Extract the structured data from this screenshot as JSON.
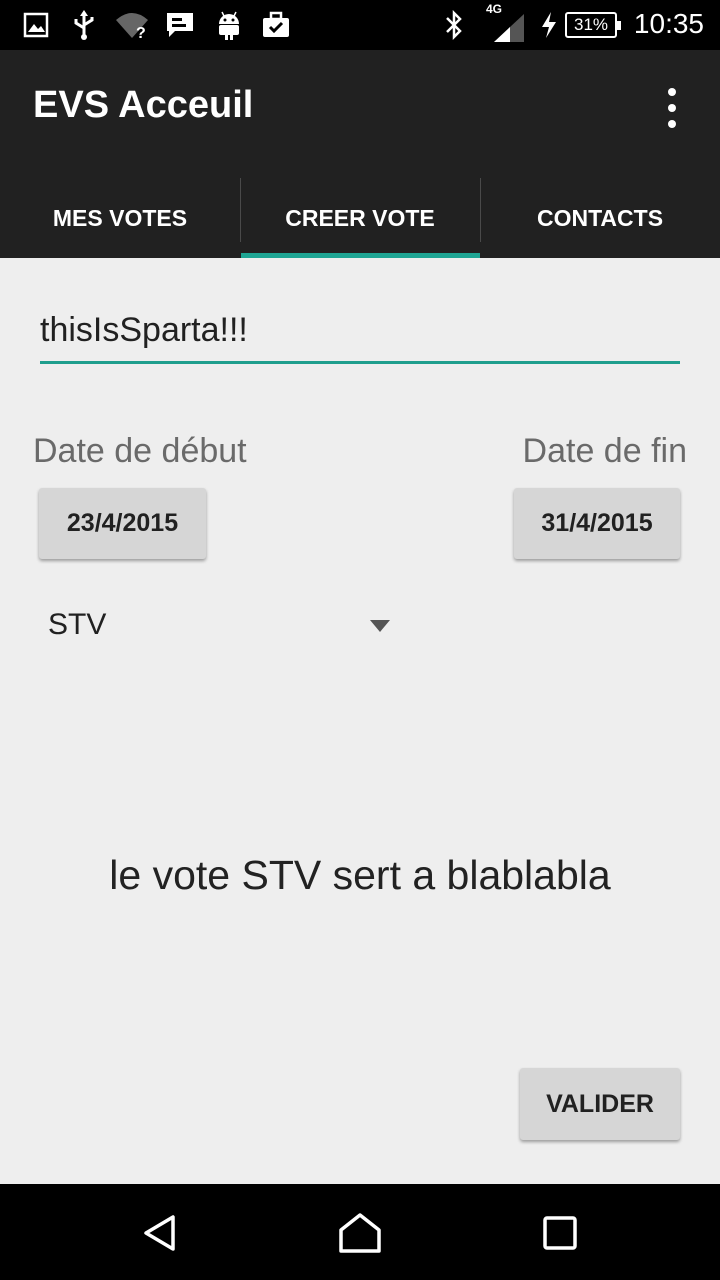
{
  "status_bar": {
    "time": "10:35",
    "battery": "31%",
    "network": "4G",
    "icons": [
      "image-icon",
      "usb-icon",
      "wifi-question-icon",
      "message-icon",
      "android-icon",
      "briefcase-check-icon",
      "bluetooth-icon",
      "signal-icon",
      "charging-icon"
    ]
  },
  "app_bar": {
    "title": "EVS Acceuil"
  },
  "tabs": [
    {
      "label": "MES VOTES",
      "selected": false
    },
    {
      "label": "CREER VOTE",
      "selected": true
    },
    {
      "label": "CONTACTS",
      "selected": false
    }
  ],
  "accent_color": "#1ea593",
  "form": {
    "vote_name": "thisIsSparta!!!",
    "start_label": "Date de début",
    "start_date": "23/4/2015",
    "end_label": "Date de fin",
    "end_date": "31/4/2015",
    "vote_type": "STV",
    "description": "le vote STV sert a blablabla",
    "submit_label": "VALIDER"
  }
}
